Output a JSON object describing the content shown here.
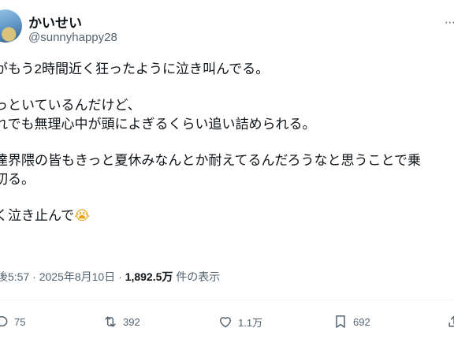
{
  "tweet": {
    "display_name": "かいせい",
    "handle": "@sunnyhappy28",
    "lines": [
      "がもう2時間近く狂ったように泣き叫んでる。",
      "っといているんだけど、",
      "れでも無理心中が頭によぎるくらい追い詰められる。",
      "達界隈の皆もきっと夏休みなんとか耐えてるんだろうなと思うことで乗",
      "切る。",
      "く泣き止んで"
    ],
    "emoji": "😭",
    "meta": {
      "time": "後5:57",
      "separator": "·",
      "date": "2025年8月10日",
      "views": "1,892.5万",
      "views_suffix": "件の表示"
    },
    "actions": {
      "replies": "75",
      "reposts": "392",
      "likes": "1.1万",
      "bookmarks": "692"
    },
    "icons": [
      "more-icon",
      "reply-icon",
      "repost-icon",
      "like-icon",
      "bookmark-icon",
      "share-icon"
    ]
  }
}
